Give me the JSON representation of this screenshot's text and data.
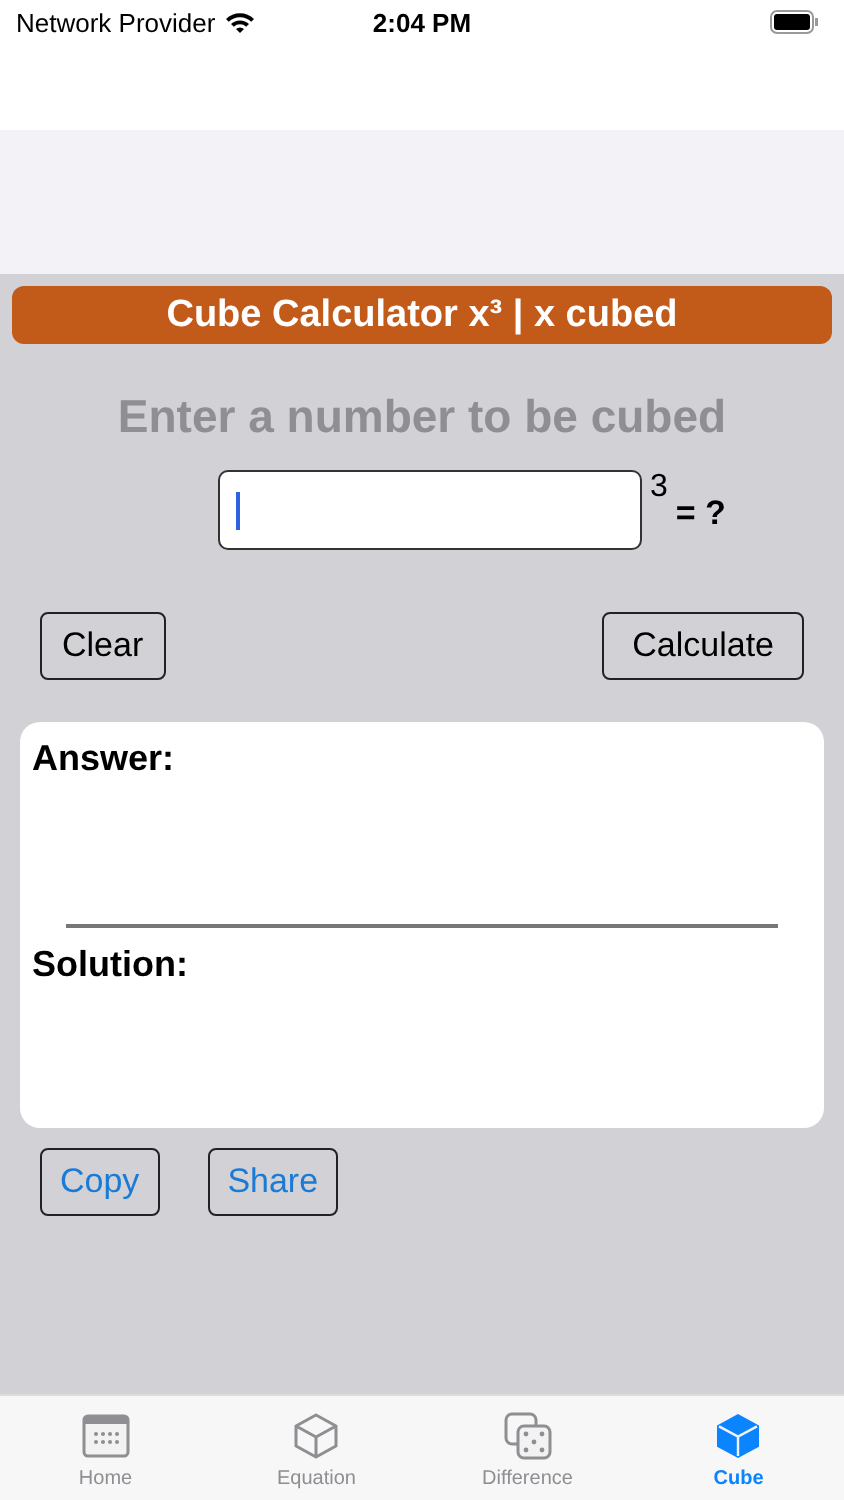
{
  "status_bar": {
    "carrier": "Network Provider",
    "time": "2:04 PM"
  },
  "banner": {
    "title": "Cube Calculator x³ | x cubed"
  },
  "prompt": "Enter a number to be cubed",
  "input": {
    "exponent": "3",
    "suffix": "= ?",
    "focused": true
  },
  "buttons": {
    "clear": "Clear",
    "calculate": "Calculate"
  },
  "result": {
    "answer_label": "Answer:",
    "solution_label": "Solution:"
  },
  "actions": [
    "Copy",
    "Share"
  ],
  "tabs": [
    {
      "label": "Home",
      "selected": false
    },
    {
      "label": "Equation",
      "selected": false
    },
    {
      "label": "Difference",
      "selected": false
    },
    {
      "label": "Cube",
      "selected": true
    }
  ]
}
